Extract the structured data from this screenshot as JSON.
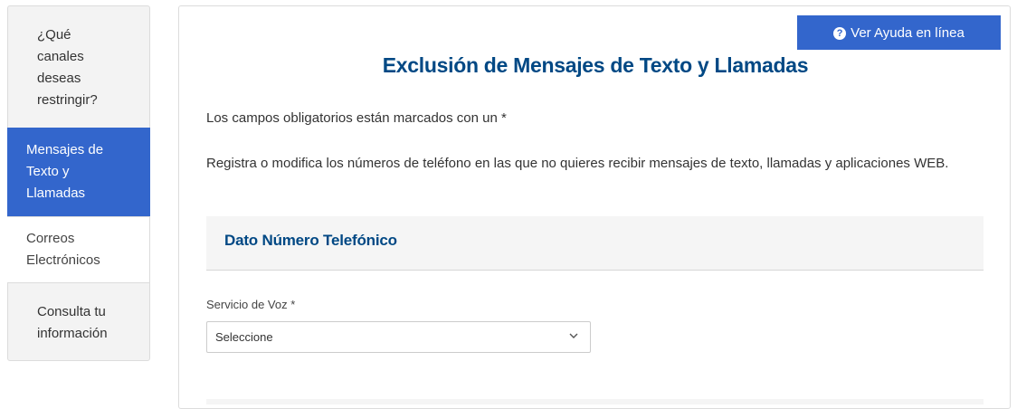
{
  "sidebar": {
    "heading_lines": [
      "¿Qué",
      "canales",
      "deseas",
      "restringir?"
    ],
    "items": [
      {
        "lines": [
          "Mensajes de",
          "Texto y",
          "Llamadas"
        ],
        "active": true
      },
      {
        "lines": [
          "Correos",
          "Electrónicos"
        ],
        "active": false
      },
      {
        "lines": [
          "Consulta tu",
          "información"
        ],
        "active": false
      }
    ]
  },
  "header": {
    "help_button_label": "Ver Ayuda en línea",
    "help_icon": "question-circle-icon",
    "title": "Exclusión de Mensajes de Texto y Llamadas"
  },
  "main": {
    "required_note": "Los campos obligatorios están marcados con un *",
    "description": "Registra o modifica los números de teléfono en las que no quieres recibir mensajes de texto, llamadas y aplicaciones WEB.",
    "section_title": "Dato Número Telefónico",
    "field_label": "Servicio de Voz *",
    "select_value": "Seleccione"
  },
  "colors": {
    "accent": "#3366cc",
    "title": "#004884"
  }
}
